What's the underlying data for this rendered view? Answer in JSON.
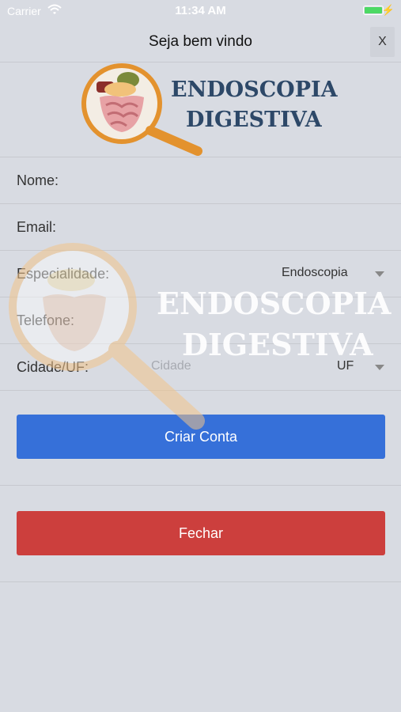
{
  "status_bar": {
    "carrier": "Carrier",
    "time": "11:34 AM"
  },
  "header": {
    "title": "Seja bem vindo",
    "close_label": "X"
  },
  "logo": {
    "line1": "ENDOSCOPIA",
    "line2": "DIGESTIVA"
  },
  "form": {
    "name_label": "Nome:",
    "email_label": "Email:",
    "specialty_label": "Especialidade:",
    "specialty_value": "Endoscopia",
    "phone_label": "Telefone:",
    "city_label": "Cidade/UF:",
    "city_placeholder": "Cidade",
    "uf_value": "UF"
  },
  "buttons": {
    "create": "Criar Conta",
    "close": "Fechar"
  },
  "colors": {
    "create": "#3670d9",
    "close": "#cc3f3d",
    "background": "#d8dbe2",
    "logo_text": "#2d4868",
    "magnifier": "#e3922e"
  }
}
